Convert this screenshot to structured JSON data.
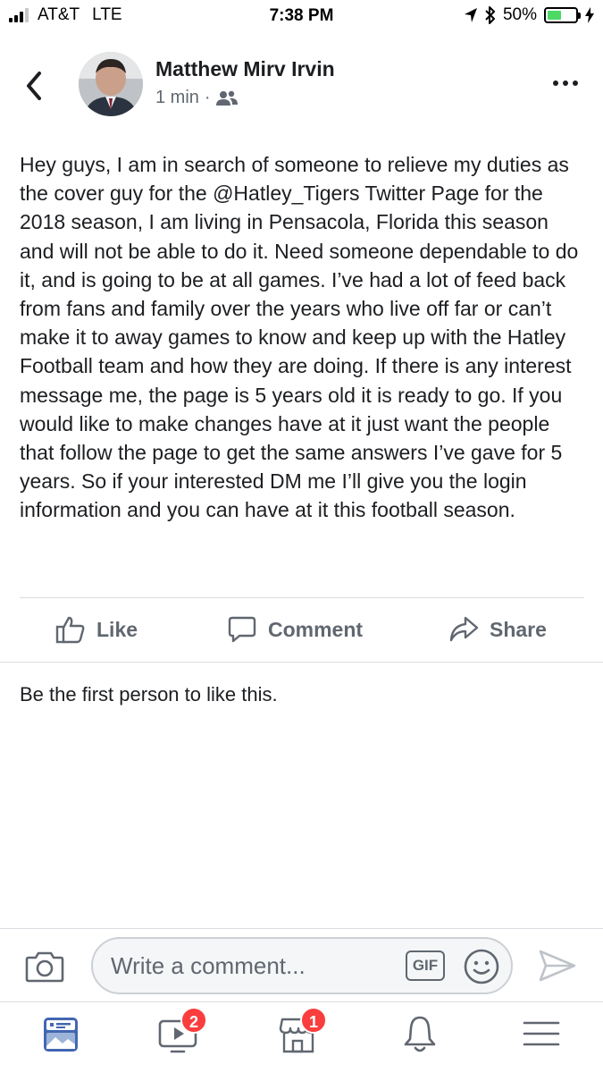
{
  "status_bar": {
    "carrier": "AT&T",
    "network": "LTE",
    "time": "7:38 PM",
    "battery": "50%",
    "battery_level": 0.5,
    "battery_color": "#4cd964"
  },
  "post": {
    "author": "Matthew Mirv Irvin",
    "timestamp": "1 min",
    "separator": "·",
    "audience_icon": "friends-icon",
    "text": "Hey guys, I am in search of someone to relieve my duties as the cover guy for the @Hatley_Tigers Twitter Page for the 2018 season, I am living in Pensacola, Florida this season and will not be able to do it. Need someone dependable to do it, and is going to be at all games. I’ve had a lot of feed back from fans and family over the years who live off far or can’t make it to away games to know and keep up with the Hatley Football team and how they are doing. If there is any interest message me, the page is 5 years old it is ready to go. If you would like to make changes have at it just want the people that follow the page to get the same answers I’ve gave for 5 years. So if your interested DM me I’ll give you the login information and you can have at it this football season."
  },
  "actions": {
    "like": "Like",
    "comment": "Comment",
    "share": "Share"
  },
  "reactions": {
    "text": "Be the first person to like this."
  },
  "composer": {
    "placeholder": "Write a comment...",
    "gif_label": "GIF"
  },
  "tabbar": {
    "watch_badge": "2",
    "marketplace_badge": "1",
    "badge_color": "#fa3e3e",
    "accent_color": "#4267b2"
  }
}
